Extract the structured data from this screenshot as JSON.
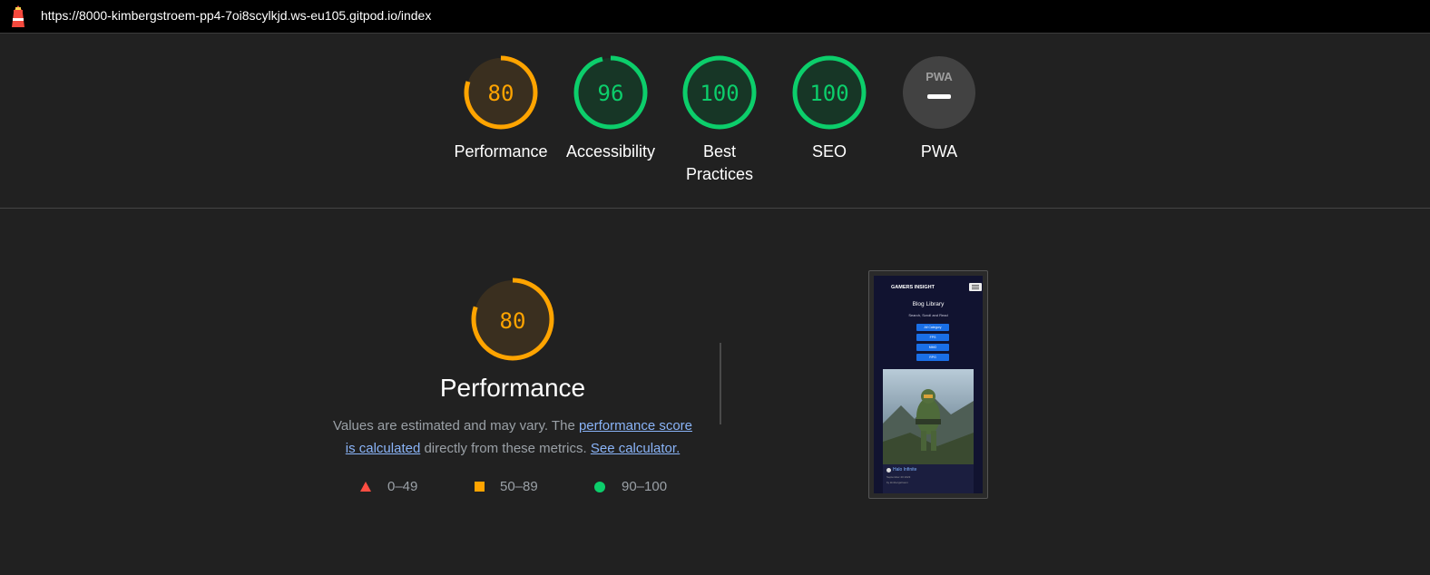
{
  "topbar": {
    "url": "https://8000-kimbergstroem-pp4-7oi8scylkjd.ws-eu105.gitpod.io/index",
    "icon": "lighthouse-icon"
  },
  "colors": {
    "pass": "#0cce6b",
    "average": "#ffa400",
    "fail": "#ff4e42",
    "link": "#8ab4f8"
  },
  "scores": [
    {
      "label": "Performance",
      "value": "80",
      "score": 80,
      "status": "average"
    },
    {
      "label": "Accessibility",
      "value": "96",
      "score": 96,
      "status": "pass"
    },
    {
      "label": "Best Practices",
      "value": "100",
      "score": 100,
      "status": "pass"
    },
    {
      "label": "SEO",
      "value": "100",
      "score": 100,
      "status": "pass"
    },
    {
      "label": "PWA",
      "value": "",
      "badge": "PWA",
      "status": "na"
    }
  ],
  "performance": {
    "score": "80",
    "title": "Performance",
    "desc_prefix": "Values are estimated and may vary. The ",
    "desc_link1": "performance score is calculated",
    "desc_middle": " directly from these metrics. ",
    "desc_link2": "See calculator."
  },
  "legend": [
    {
      "range": "0–49",
      "shape": "triangle"
    },
    {
      "range": "50–89",
      "shape": "square"
    },
    {
      "range": "90–100",
      "shape": "circle"
    }
  ],
  "screenshot": {
    "brand": "GAMERS INSIGHT",
    "title": "Blog Library",
    "subtitle": "Search, Scroll and Read",
    "buttons": [
      "All Category",
      "FPS",
      "MMO",
      "RPG"
    ],
    "post_title": "Halo Infinite",
    "post_date": "September 20 2023",
    "post_by": "by kimbergstroem"
  }
}
